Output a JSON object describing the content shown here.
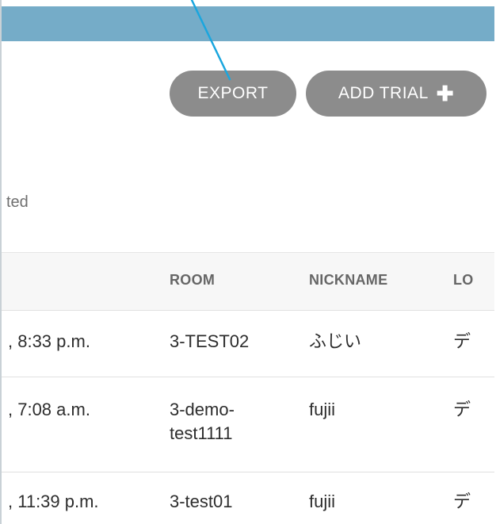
{
  "toolbar": {
    "export_label": "EXPORT",
    "add_trial_label": "ADD TRIAL",
    "add_icon": "plus-icon"
  },
  "status": {
    "text": "ted"
  },
  "table": {
    "headers": {
      "room": "ROOM",
      "nickname": "NICKNAME",
      "location": "LO"
    },
    "rows": [
      {
        "date": ", 8:33 p.m.",
        "room": "3-TEST02",
        "nickname": "ふじい",
        "location": "デ"
      },
      {
        "date": ", 7:08 a.m.",
        "room": "3-demo-test1111",
        "room_line1": "3-demo-",
        "room_line2": "test1111",
        "nickname": "fujii",
        "location": "デ"
      },
      {
        "date": ", 11:39 p.m.",
        "room": "3-test01",
        "nickname": "fujii",
        "location": "デ"
      }
    ]
  },
  "colors": {
    "top_bar": "#75acc8",
    "button_bg": "#8c8c8c",
    "annotation_line": "#1aa6de"
  }
}
